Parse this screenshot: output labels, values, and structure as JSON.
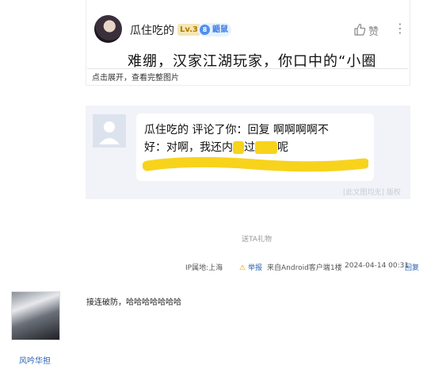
{
  "post": {
    "username": "瓜住吃的",
    "level": "Lv.3",
    "tag": "鼯鼠",
    "tag_dot": "8",
    "like_label": "赞",
    "more_symbol": "⋮",
    "title": "难绷，汉家江湖玩家，你口中的“小圈",
    "expand_note": "点击展开，查看完整图片"
  },
  "notification": {
    "line1": "瓜住吃的 评论了你：回复 啊啊啊啊不",
    "line2_a": "好：对啊，我还内",
    "line2_b": "过",
    "line2_c": "呢",
    "watermark": "[此文图均无] 版权"
  },
  "footer": {
    "gift": "送TA礼物",
    "ip": "IP属地:上海",
    "report": "举报",
    "client": "来自Android客户端",
    "floor": "1楼",
    "datetime": "2024-04-14 00:31",
    "reply": "回复"
  },
  "reply": {
    "username": "风吟华担",
    "text": "接连破防，哈哈哈哈哈哈哈"
  },
  "colors": {
    "redaction": "#f7d31c",
    "link": "#2d64b3",
    "notif_bg": "#f1f3f8"
  }
}
